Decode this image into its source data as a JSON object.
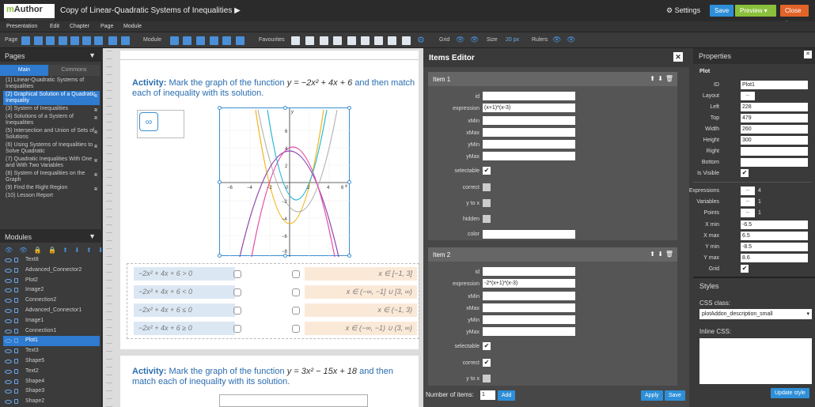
{
  "app": {
    "logo_main": "m",
    "logo_rest": "Author",
    "logo_sub": "Learning Authoring & Publishing Environment",
    "title": "Copy of Linear-Quadratic Systems of Inequalities",
    "settings": "Settings",
    "save": "Save",
    "preview": "Preview",
    "close": "Close",
    "colors": {
      "save": "#2e8fd8",
      "preview": "#8ac03c",
      "close": "#e2632a",
      "accent": "#2e7bd0"
    }
  },
  "menu": [
    "Presentation",
    "Edit",
    "Chapter",
    "Page",
    "Module"
  ],
  "toolbar": {
    "page": "Page",
    "module": "Module",
    "favourites": "Favourites",
    "grid": "Grid",
    "size": "Size",
    "size_value": "20 px",
    "rulers": "Rulers"
  },
  "pages": {
    "title": "Pages",
    "tab_main": "Main",
    "tab_commons": "Commons",
    "items": [
      {
        "label": "(1) Linear-Quadratic Systems of Inequalities",
        "r": ""
      },
      {
        "label": "(2) Graphical Solution of a Quadratic Inequality",
        "r": "R",
        "selected": true
      },
      {
        "label": "(3) System of Inequalities",
        "r": "R"
      },
      {
        "label": "(4) Solutions of a System of Inequalities",
        "r": "R"
      },
      {
        "label": "(5) Intersection and Union of Sets of Solutions",
        "r": "R"
      },
      {
        "label": "(6) Using Systems of Inequalities to Solve Quadratic",
        "r": "R"
      },
      {
        "label": "(7) Quadratic Inequalities With One and With Two Variables",
        "r": "R"
      },
      {
        "label": "(8) System of Inequalities on the Graph",
        "r": "R"
      },
      {
        "label": "(9) Find the Right Region",
        "r": "R"
      },
      {
        "label": "(10) Lesson Report",
        "r": ""
      }
    ]
  },
  "modules": {
    "title": "Modules",
    "items": [
      "Text8",
      "Advanced_Connector2",
      "Plot2",
      "Image2",
      "Connection2",
      "Advanced_Connector1",
      "Image1",
      "Connection1",
      "Plot1",
      "Text3",
      "Shape5",
      "Text2",
      "Shape4",
      "Shape3",
      "Shape2"
    ],
    "selected": "Plot1"
  },
  "activity1": {
    "bold": "Activity:",
    "text": "Mark the graph of the function",
    "formula": "y = −2x² + 4x + 6",
    "text2": "and then match each of inequality with its solution."
  },
  "activity2": {
    "bold": "Activity:",
    "text": "Mark the graph of the function",
    "formula": "y = 3x² − 15x + 18",
    "text2": "and then match each of inequality with its solution."
  },
  "plot": {
    "x_ticks": [
      "−6",
      "−4",
      "−2",
      "0",
      "2",
      "4",
      "6"
    ],
    "y_ticks": [
      "6",
      "4",
      "2",
      "−2",
      "−4",
      "−6",
      "−8"
    ],
    "x_label": "x",
    "y_label": "y"
  },
  "inequalities": [
    "−2x² + 4x + 6 > 0",
    "−2x² + 4x + 6 < 0",
    "−2x² + 4x + 6 ≤ 0",
    "−2x² + 4x + 6 ≥ 0"
  ],
  "solutions": [
    "x ∈ [−1, 3]",
    "x ∈ (−∞, −1] ∪ [3, ∞)",
    "x ∈ (−1, 3)",
    "x ∈ (−∞, −1) ∪ (3, ∞)"
  ],
  "editor": {
    "title": "Items Editor",
    "item1": {
      "title": "Item 1",
      "expression": "(x+1)*(x-3)"
    },
    "item2": {
      "title": "Item 2",
      "expression": "-2*(x+1)*(x-3)"
    },
    "labels": {
      "id": "id",
      "expression": "expression",
      "xmin": "xMin",
      "xmax": "xMax",
      "ymin": "yMin",
      "ymax": "yMax",
      "selectable": "selectable",
      "correct": "correct",
      "ytox": "y to x",
      "hidden": "hidden",
      "color": "color"
    },
    "num_items_label": "Number of items:",
    "num_items": "1",
    "add": "Add",
    "apply": "Apply",
    "save": "Save"
  },
  "properties": {
    "title": "Properties",
    "section": "Plot",
    "id_label": "ID",
    "id": "Plot1",
    "layout_label": "Layout",
    "left_label": "Left",
    "left": "228",
    "top_label": "Top",
    "top": "479",
    "width_label": "Width",
    "width": "260",
    "height_label": "Height",
    "height": "300",
    "right_label": "Right",
    "bottom_label": "Bottom",
    "visible_label": "Is Visible",
    "expr_label": "Expressions",
    "expr": "4",
    "vars_label": "Variables",
    "vars": "1",
    "points_label": "Points",
    "points": "1",
    "xmin_label": "X min",
    "xmin": "-6.5",
    "xmax_label": "X max",
    "xmax": "6.5",
    "ymin_label": "Y min",
    "ymin": "-8.5",
    "ymax_label": "Y max",
    "ymax": "8.6",
    "grid_label": "Grid",
    "dots": "..."
  },
  "styles": {
    "title": "Styles",
    "css_class_label": "CSS class:",
    "css_class": "plotAddon_description_small",
    "inline_label": "Inline CSS:",
    "update": "Update style"
  }
}
